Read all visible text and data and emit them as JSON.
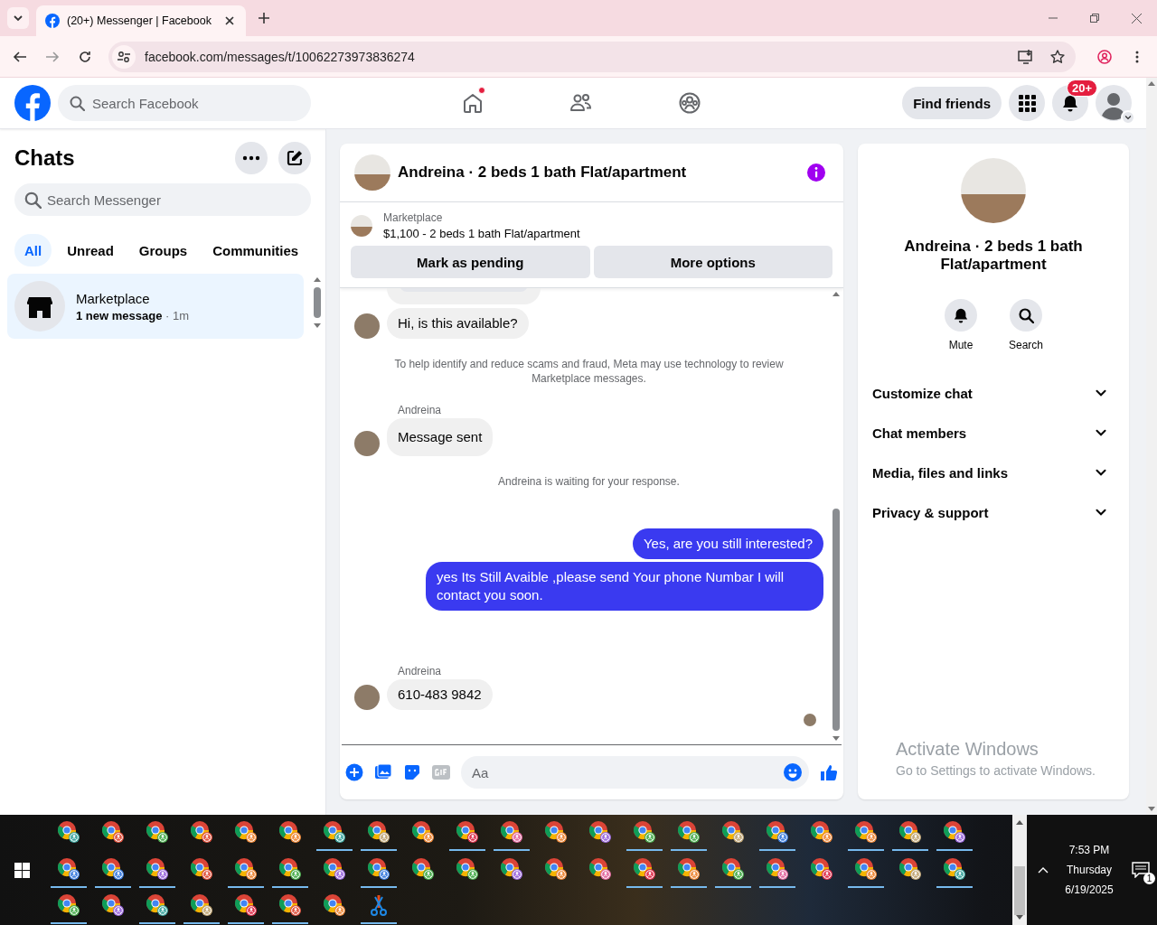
{
  "browser": {
    "tab_title": "(20+) Messenger | Facebook",
    "url": "facebook.com/messages/t/10062273973836274"
  },
  "header": {
    "search_placeholder": "Search Facebook",
    "nav": [
      {
        "kind": "home",
        "selected": false,
        "has_dot": true
      },
      {
        "kind": "friends",
        "selected": false,
        "has_dot": false
      },
      {
        "kind": "groups",
        "selected": false,
        "has_dot": false
      }
    ],
    "find_friends": "Find friends",
    "notification_count": "20+"
  },
  "sidebar": {
    "title": "Chats",
    "search_placeholder": "Search Messenger",
    "filters": [
      {
        "label": "All",
        "selected": true
      },
      {
        "label": "Unread",
        "selected": false
      },
      {
        "label": "Groups",
        "selected": false
      },
      {
        "label": "Communities",
        "selected": false
      }
    ],
    "chats": [
      {
        "name": "Marketplace",
        "preview": "1 new message",
        "time": "· 1m",
        "selected": true,
        "unread": true
      }
    ]
  },
  "chat": {
    "title": "Andreina · 2 beds 1 bath Flat/apartment",
    "listing": {
      "label": "Marketplace",
      "title": "$1,100 - 2 beds 1 bath Flat/apartment",
      "buttons": [
        "Mark as pending",
        "More options"
      ]
    },
    "messages": [
      {
        "kind": "clipped"
      },
      {
        "kind": "incoming",
        "text": "Hi, is this available?"
      },
      {
        "kind": "notice",
        "text": "To help identify and reduce scams and fraud, Meta may use technology to review Marketplace messages."
      },
      {
        "kind": "sender",
        "text": "Andreina"
      },
      {
        "kind": "incoming",
        "text": "Message sent",
        "large": true
      },
      {
        "kind": "notice",
        "text": "Andreina is waiting for your response."
      },
      {
        "kind": "outgoing",
        "text": "Yes, are you still interested?"
      },
      {
        "kind": "outgoing",
        "text": "yes Its Still Avaible ,please send Your phone Numbar I will contact you soon."
      },
      {
        "kind": "sender",
        "text": "Andreina"
      },
      {
        "kind": "incoming",
        "text": "610-483 9842"
      },
      {
        "kind": "seen"
      }
    ],
    "composer": {
      "placeholder": "Aa"
    }
  },
  "details": {
    "name": "Andreina · 2 beds 1 bath Flat/apartment",
    "actions": [
      {
        "kind": "bell",
        "label": "Mute"
      },
      {
        "kind": "search",
        "label": "Search"
      }
    ],
    "sections": [
      "Customize chat",
      "Chat members",
      "Media, files and links",
      "Privacy & support"
    ]
  },
  "activation": {
    "title": "Activate Windows",
    "text": "Go to Settings to activate Windows."
  },
  "taskbar": {
    "rows": [
      [
        {
          "kind": "chrome",
          "color": "#3fa7a0",
          "running": false
        },
        {
          "kind": "chrome",
          "color": "#e0533f",
          "running": false
        },
        {
          "kind": "chrome",
          "color": "#4caf50",
          "running": false
        },
        {
          "kind": "chrome",
          "color": "#e0533f",
          "running": false
        },
        {
          "kind": "chrome",
          "color": "#ef8a3a",
          "running": false
        },
        {
          "kind": "chrome",
          "color": "#ef8a3a",
          "running": false
        },
        {
          "kind": "chrome",
          "color": "#3fa7a0",
          "running": true
        },
        {
          "kind": "chrome",
          "color": "#c2a878",
          "running": true
        },
        {
          "kind": "chrome",
          "color": "#ef8a3a",
          "running": false
        },
        {
          "kind": "chrome",
          "color": "#e0334f",
          "running": true
        },
        {
          "kind": "chrome",
          "color": "#e36aa0",
          "running": true
        },
        {
          "kind": "chrome",
          "color": "#ef8a3a",
          "running": false
        },
        {
          "kind": "chrome",
          "color": "#9c6ade",
          "running": false
        },
        {
          "kind": "chrome",
          "color": "#4caf50",
          "running": true
        },
        {
          "kind": "chrome",
          "color": "#4caf50",
          "running": true
        },
        {
          "kind": "chrome",
          "color": "#c2a878",
          "running": false
        },
        {
          "kind": "chrome",
          "color": "#3f7fe0",
          "running": true
        },
        {
          "kind": "chrome",
          "color": "#ef8a3a",
          "running": false
        },
        {
          "kind": "chrome",
          "color": "#ef8a3a",
          "running": true
        },
        {
          "kind": "chrome",
          "color": "#c2a878",
          "running": true
        },
        {
          "kind": "chrome",
          "color": "#9c6ade",
          "running": true
        }
      ],
      [
        {
          "kind": "chrome",
          "color": "#3f7fe0",
          "running": true
        },
        {
          "kind": "chrome",
          "color": "#3f7fe0",
          "running": true
        },
        {
          "kind": "chrome",
          "color": "#9c6ade",
          "running": true
        },
        {
          "kind": "chrome",
          "color": "#e0533f",
          "running": false
        },
        {
          "kind": "chrome",
          "color": "#ef8a3a",
          "running": true
        },
        {
          "kind": "chrome",
          "color": "#4caf50",
          "running": true
        },
        {
          "kind": "chrome",
          "color": "#9c6ade",
          "running": false
        },
        {
          "kind": "chrome",
          "color": "#3f7fe0",
          "running": true
        },
        {
          "kind": "chrome",
          "color": "#4caf50",
          "running": false
        },
        {
          "kind": "chrome",
          "color": "#4caf50",
          "running": false
        },
        {
          "kind": "chrome",
          "color": "#9c6ade",
          "running": false
        },
        {
          "kind": "chrome",
          "color": "#ef8a3a",
          "running": false
        },
        {
          "kind": "chrome",
          "color": "#e36aa0",
          "running": false
        },
        {
          "kind": "chrome",
          "color": "#e0334f",
          "running": true
        },
        {
          "kind": "chrome",
          "color": "#ef8a3a",
          "running": true
        },
        {
          "kind": "chrome",
          "color": "#4caf50",
          "running": true
        },
        {
          "kind": "chrome",
          "color": "#e36aa0",
          "running": true
        },
        {
          "kind": "chrome",
          "color": "#e0334f",
          "running": false
        },
        {
          "kind": "chrome",
          "color": "#ef8a3a",
          "running": true
        },
        {
          "kind": "chrome",
          "color": "#c2a878",
          "running": false
        },
        {
          "kind": "chrome",
          "color": "#3fa7a0",
          "running": true
        }
      ],
      [
        {
          "kind": "chrome",
          "color": "#4caf50",
          "running": true
        },
        {
          "kind": "chrome",
          "color": "#9c6ade",
          "running": false
        },
        {
          "kind": "chrome",
          "color": "#3fa7a0",
          "running": true
        },
        {
          "kind": "chrome",
          "color": "#c2a878",
          "running": true
        },
        {
          "kind": "chrome",
          "color": "#e0334f",
          "running": true
        },
        {
          "kind": "chrome",
          "color": "#e0533f",
          "running": true
        },
        {
          "kind": "chrome",
          "color": "#ef8a3a",
          "running": false
        },
        {
          "kind": "snip",
          "running": true
        }
      ]
    ],
    "clock": {
      "time": "7:53 PM",
      "day": "Thursday",
      "date": "6/19/2025"
    },
    "notification_count": "1"
  }
}
